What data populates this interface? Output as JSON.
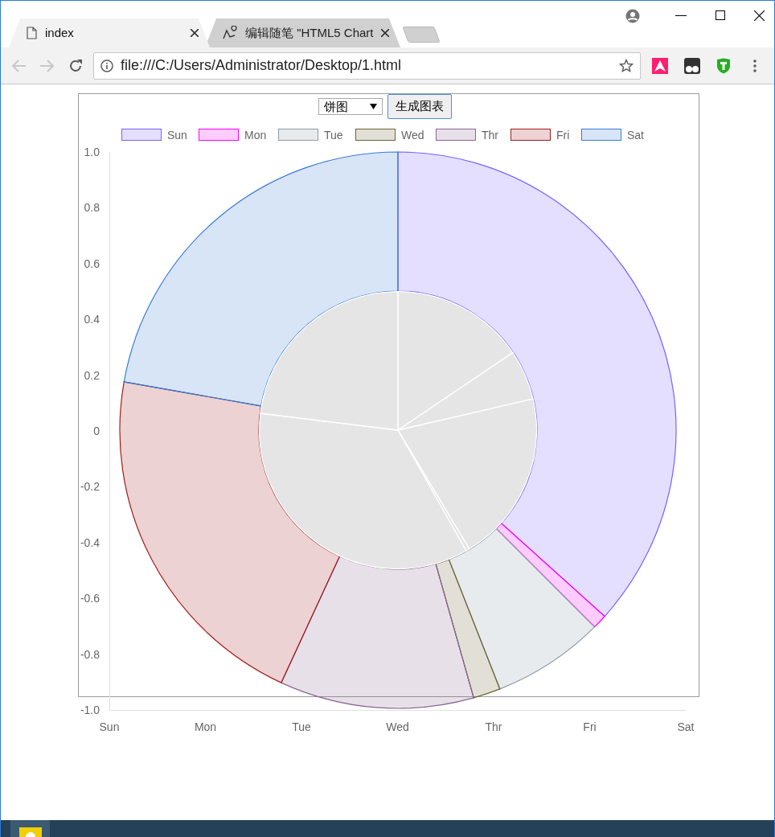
{
  "browser": {
    "tabs": [
      {
        "title": "index",
        "selected": true
      },
      {
        "title": "编辑随笔 \"HTML5 Chart",
        "selected": false
      }
    ],
    "address": "file:///C:/Users/Administrator/Desktop/1.html"
  },
  "page": {
    "chart_type_select": "饼图",
    "generate_button": "生成图表"
  },
  "chart": {
    "legend": [
      {
        "label": "Sun",
        "color": "#7b61ff"
      },
      {
        "label": "Mon",
        "color": "#ff00ff"
      },
      {
        "label": "Tue",
        "color": "#8c9ba5"
      },
      {
        "label": "Wed",
        "color": "#6e6334"
      },
      {
        "label": "Thr",
        "color": "#8a6593"
      },
      {
        "label": "Fri",
        "color": "#a01f1f"
      },
      {
        "label": "Sat",
        "color": "#3a7bd5"
      }
    ],
    "y_ticks": [
      "1.0",
      "0.8",
      "0.6",
      "0.4",
      "0.2",
      "0",
      "-0.2",
      "-0.4",
      "-0.6",
      "-0.8",
      "-1.0"
    ],
    "x_labels": [
      "Sun",
      "Mon",
      "Tue",
      "Wed",
      "Thr",
      "Fri",
      "Sat"
    ]
  }
}
